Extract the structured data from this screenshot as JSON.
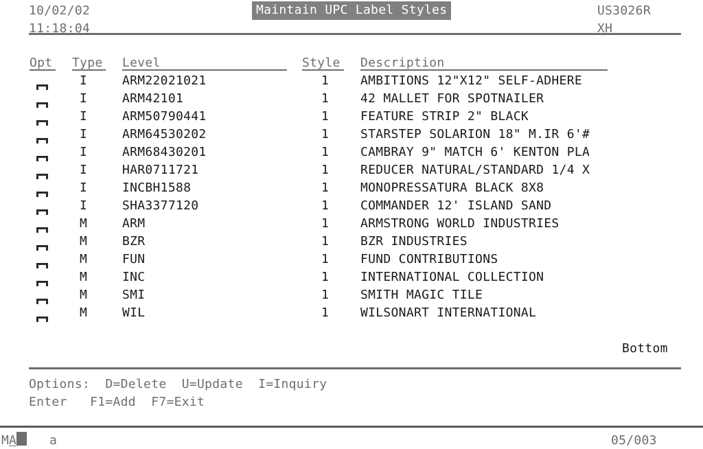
{
  "header": {
    "date": "10/02/02",
    "time": "11:18:04",
    "title": "Maintain UPC Label Styles",
    "program_id": "US3026R",
    "workstation": "XH"
  },
  "columns": {
    "opt": "Opt",
    "type": "Type",
    "level": "Level",
    "style": "Style",
    "description": "Description"
  },
  "rows": [
    {
      "type": "I",
      "level": "ARM22021021",
      "style": "1",
      "description": "AMBITIONS 12\"X12\" SELF-ADHERE"
    },
    {
      "type": "I",
      "level": "ARM42101",
      "style": "1",
      "description": "42 MALLET FOR SPOTNAILER"
    },
    {
      "type": "I",
      "level": "ARM50790441",
      "style": "1",
      "description": "FEATURE STRIP 2\" BLACK"
    },
    {
      "type": "I",
      "level": "ARM64530202",
      "style": "1",
      "description": "STARSTEP SOLARION 18\" M.IR 6'#"
    },
    {
      "type": "I",
      "level": "ARM68430201",
      "style": "1",
      "description": "CAMBRAY 9\" MATCH 6' KENTON PLA"
    },
    {
      "type": "I",
      "level": "HAR0711721",
      "style": "1",
      "description": "REDUCER NATURAL/STANDARD 1/4 X"
    },
    {
      "type": "I",
      "level": "INCBH1588",
      "style": "1",
      "description": "MONOPRESSATURA BLACK 8X8"
    },
    {
      "type": "I",
      "level": "SHA3377120",
      "style": "1",
      "description": "COMMANDER 12' ISLAND SAND"
    },
    {
      "type": "M",
      "level": "ARM",
      "style": "1",
      "description": "ARMSTRONG WORLD INDUSTRIES"
    },
    {
      "type": "M",
      "level": "BZR",
      "style": "1",
      "description": "BZR INDUSTRIES"
    },
    {
      "type": "M",
      "level": "FUN",
      "style": "1",
      "description": "FUND CONTRIBUTIONS"
    },
    {
      "type": "M",
      "level": "INC",
      "style": "1",
      "description": "INTERNATIONAL COLLECTION"
    },
    {
      "type": "M",
      "level": "SMI",
      "style": "1",
      "description": "SMITH MAGIC TILE"
    },
    {
      "type": "M",
      "level": "WIL",
      "style": "1",
      "description": "WILSONART INTERNATIONAL"
    }
  ],
  "scroll_indicator": "Bottom",
  "footer": {
    "options_line": "Options:  D=Delete  U=Update  I=Inquiry",
    "keys_line": "Enter   F1=Add  F7=Exit"
  },
  "statusbar": {
    "mode_m": "M",
    "mode_a": "A",
    "input_indicator": "a",
    "position": "05/003"
  },
  "colors": {
    "background": "#ffffff",
    "text_gray": "#6e6e6e",
    "text_black": "#1a1a1a",
    "reverse_bg": "#808080",
    "reverse_fg": "#ffffff"
  }
}
